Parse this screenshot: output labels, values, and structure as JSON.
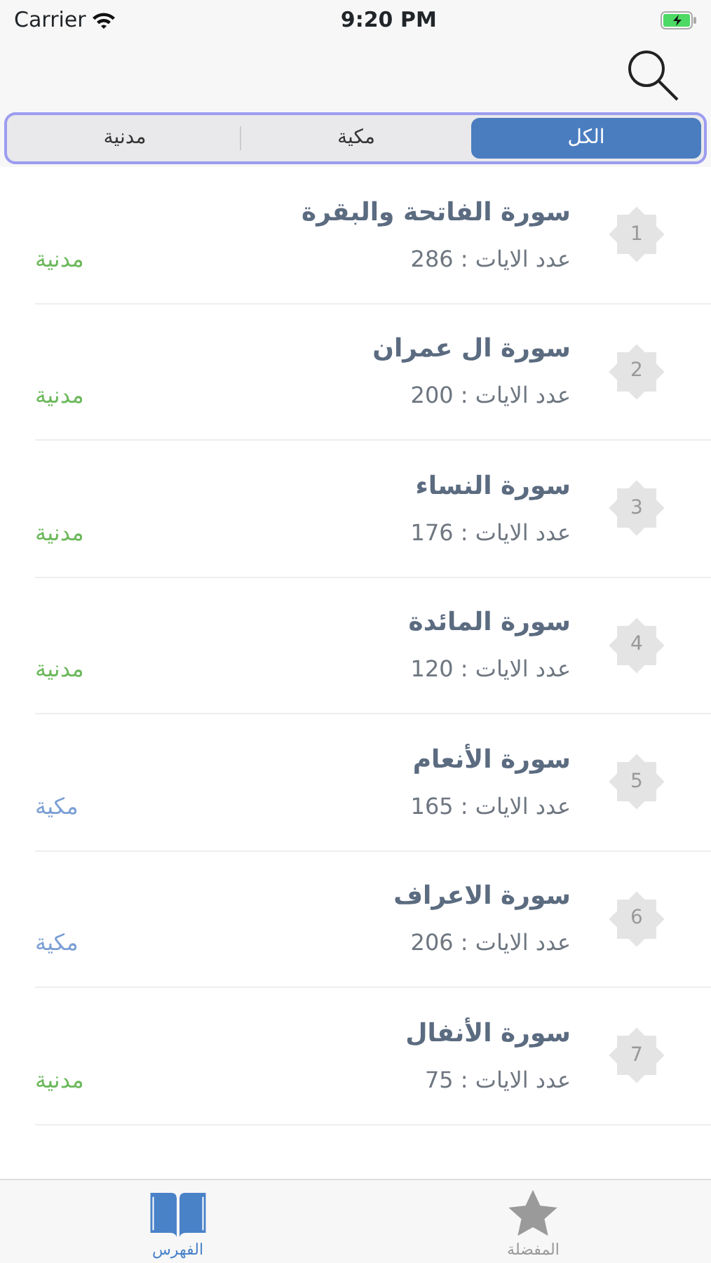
{
  "status_bar": {
    "carrier": "Carrier",
    "time": "9:20 PM"
  },
  "segments": [
    {
      "label": "الكل",
      "selected": true
    },
    {
      "label": "مكية",
      "selected": false
    },
    {
      "label": "مدنية",
      "selected": false
    }
  ],
  "surahs": [
    {
      "number": "1",
      "title": "سورة الفاتحة والبقرة",
      "verses": "عدد الايات : 286",
      "type": "مدنية",
      "color": "#6cb85c"
    },
    {
      "number": "2",
      "title": "سورة ال عمران",
      "verses": "عدد الايات : 200",
      "type": "مدنية",
      "color": "#6cb85c"
    },
    {
      "number": "3",
      "title": "سورة النساء",
      "verses": "عدد الايات : 176",
      "type": "مدنية",
      "color": "#6cb85c"
    },
    {
      "number": "4",
      "title": "سورة المائدة",
      "verses": "عدد الايات : 120",
      "type": "مدنية",
      "color": "#6cb85c"
    },
    {
      "number": "5",
      "title": "سورة الأنعام",
      "verses": "عدد الايات : 165",
      "type": "مكية",
      "color": "#7b9fd4"
    },
    {
      "number": "6",
      "title": "سورة الاعراف",
      "verses": "عدد الايات : 206",
      "type": "مكية",
      "color": "#7b9fd4"
    },
    {
      "number": "7",
      "title": "سورة الأنفال",
      "verses": "عدد الايات : 75",
      "type": "مدنية",
      "color": "#6cb85c"
    }
  ],
  "tab_bar": [
    {
      "kind": "star",
      "label": "المفضلة",
      "selected": false
    },
    {
      "kind": "book",
      "label": "الفهرس",
      "selected": true
    }
  ]
}
